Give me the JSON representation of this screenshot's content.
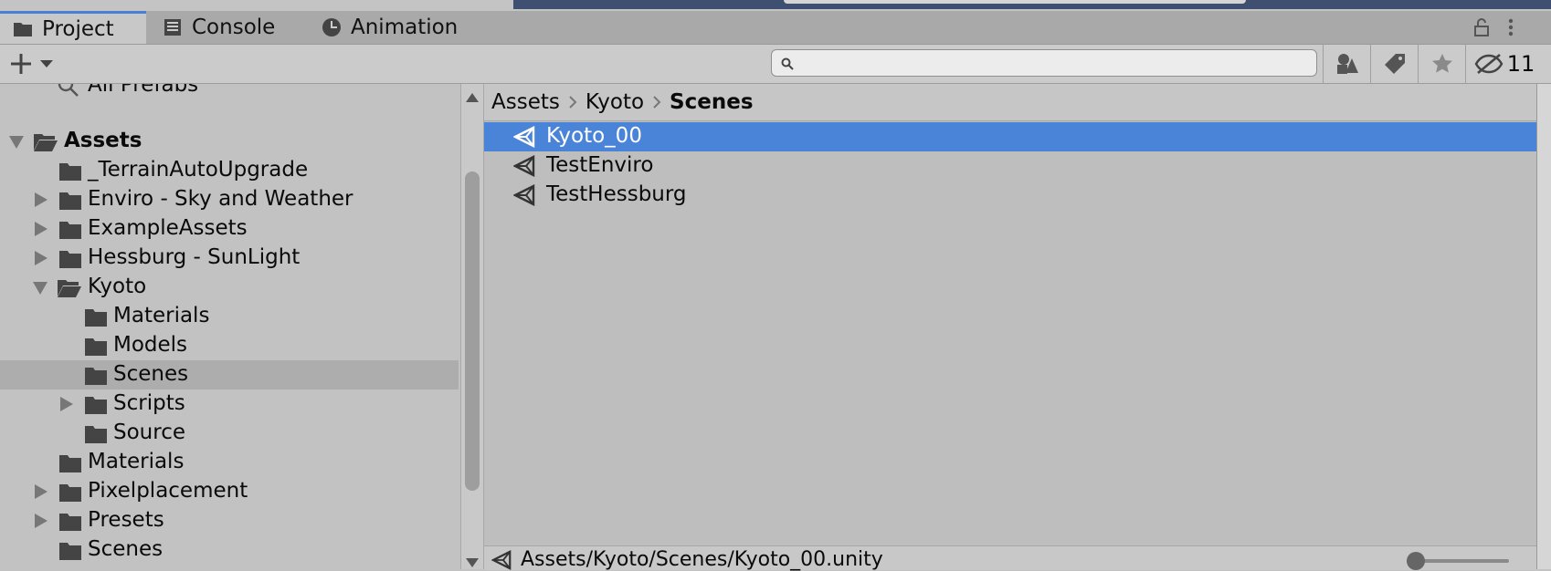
{
  "tabs": [
    {
      "label": "Project",
      "icon": "folder-icon",
      "active": true
    },
    {
      "label": "Console",
      "icon": "console-icon"
    },
    {
      "label": "Animation",
      "icon": "clock-icon"
    }
  ],
  "toolbar": {
    "search_value": "",
    "hidden_count": "11"
  },
  "tree": [
    {
      "label": "All Prefabs",
      "depth": 1,
      "icon": "search-icon",
      "partial": true
    },
    {
      "label": "Assets",
      "depth": 0,
      "expanded": true,
      "bold": true,
      "open_folder": true
    },
    {
      "label": "_TerrainAutoUpgrade",
      "depth": 1
    },
    {
      "label": "Enviro - Sky and Weather",
      "depth": 1,
      "collapsed": true
    },
    {
      "label": "ExampleAssets",
      "depth": 1,
      "collapsed": true
    },
    {
      "label": "Hessburg - SunLight",
      "depth": 1,
      "collapsed": true
    },
    {
      "label": "Kyoto",
      "depth": 1,
      "expanded": true,
      "open_folder": true
    },
    {
      "label": "Materials",
      "depth": 2
    },
    {
      "label": "Models",
      "depth": 2
    },
    {
      "label": "Scenes",
      "depth": 2,
      "selected": true
    },
    {
      "label": "Scripts",
      "depth": 2,
      "collapsed": true
    },
    {
      "label": "Source",
      "depth": 2
    },
    {
      "label": "Materials",
      "depth": 1
    },
    {
      "label": "Pixelplacement",
      "depth": 1,
      "collapsed": true
    },
    {
      "label": "Presets",
      "depth": 1,
      "collapsed": true
    },
    {
      "label": "Scenes",
      "depth": 1
    }
  ],
  "breadcrumb": [
    "Assets",
    "Kyoto",
    "Scenes"
  ],
  "files": [
    {
      "label": "Kyoto_00",
      "selected": true
    },
    {
      "label": "TestEnviro"
    },
    {
      "label": "TestHessburg"
    }
  ],
  "status": {
    "path": "Assets/Kyoto/Scenes/Kyoto_00.unity"
  },
  "colors": {
    "selection": "#4a84d9",
    "tab_accent": "#4a7fd6",
    "panel": "#c2c2c2"
  }
}
